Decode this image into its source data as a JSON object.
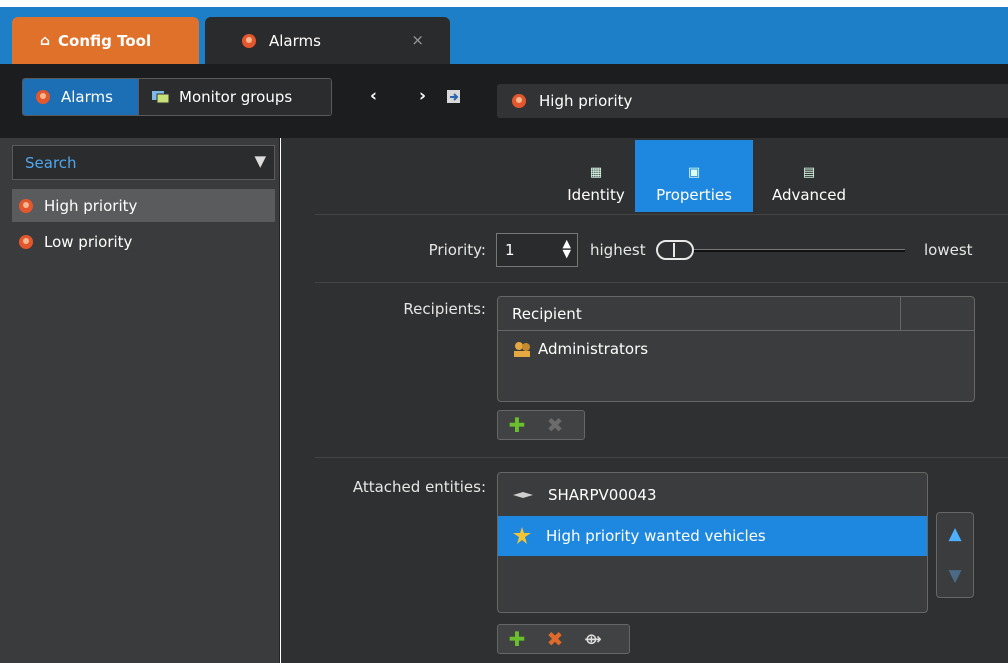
{
  "titlebar": {
    "config_tab": "Config Tool",
    "alarms_tab": "Alarms",
    "close_glyph": "×"
  },
  "toolbar": {
    "alarms_btn": "Alarms",
    "monitor_groups_btn": "Monitor groups",
    "back_glyph": "‹",
    "forward_glyph": "›",
    "breadcrumb": "High priority"
  },
  "sidebar": {
    "search_placeholder": "Search",
    "items": [
      {
        "label": "High priority",
        "selected": true
      },
      {
        "label": "Low priority",
        "selected": false
      }
    ]
  },
  "tabs": [
    {
      "label": "Identity",
      "active": false
    },
    {
      "label": "Properties",
      "active": true
    },
    {
      "label": "Advanced",
      "active": false
    }
  ],
  "priority": {
    "label": "Priority:",
    "value": "1",
    "highest": "highest",
    "lowest": "lowest"
  },
  "recipients": {
    "label": "Recipients:",
    "column": "Recipient",
    "rows": [
      "Administrators"
    ]
  },
  "attached": {
    "label": "Attached entities:",
    "items": [
      {
        "label": "SHARPV00043",
        "selected": false
      },
      {
        "label": "High priority wanted vehicles",
        "selected": true
      }
    ]
  },
  "colors": {
    "accent": "#1e88e0",
    "config_tab": "#e0712a",
    "titlebar": "#1e7fc9"
  }
}
